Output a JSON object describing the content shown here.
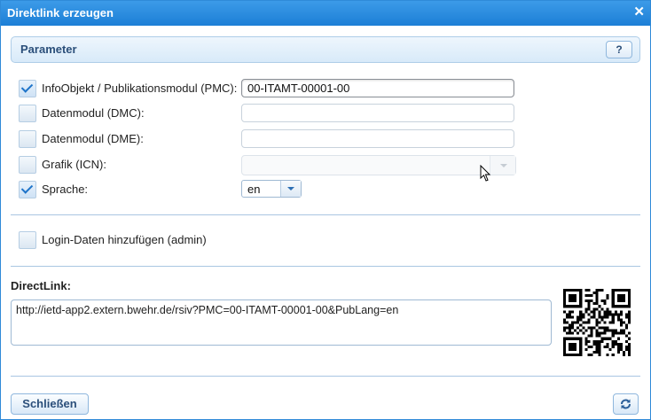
{
  "window": {
    "title": "Direktlink erzeugen",
    "close_glyph": "✕"
  },
  "panel": {
    "title": "Parameter",
    "help_label": "?"
  },
  "rows": [
    {
      "label": "InfoObjekt / Publikationsmodul (PMC):",
      "checked": true,
      "value": "00-ITAMT-00001-00"
    },
    {
      "label": "Datenmodul (DMC):",
      "checked": false,
      "value": ""
    },
    {
      "label": "Datenmodul (DME):",
      "checked": false,
      "value": ""
    },
    {
      "label": "Grafik (ICN):",
      "checked": false,
      "value": ""
    },
    {
      "label": "Sprache:",
      "checked": true,
      "value": "en"
    }
  ],
  "login": {
    "label": "Login-Daten hinzufügen (admin)",
    "checked": false
  },
  "directlink": {
    "label": "DirectLink:",
    "url": "http://ietd-app2.extern.bwehr.de/rsiv?PMC=00-ITAMT-00001-00&PubLang=en"
  },
  "footer": {
    "close_label": "Schließen"
  },
  "colors": {
    "titlebar": "#1c7fd6",
    "accent": "#2b4f7a",
    "separator": "#a9c6e2"
  }
}
